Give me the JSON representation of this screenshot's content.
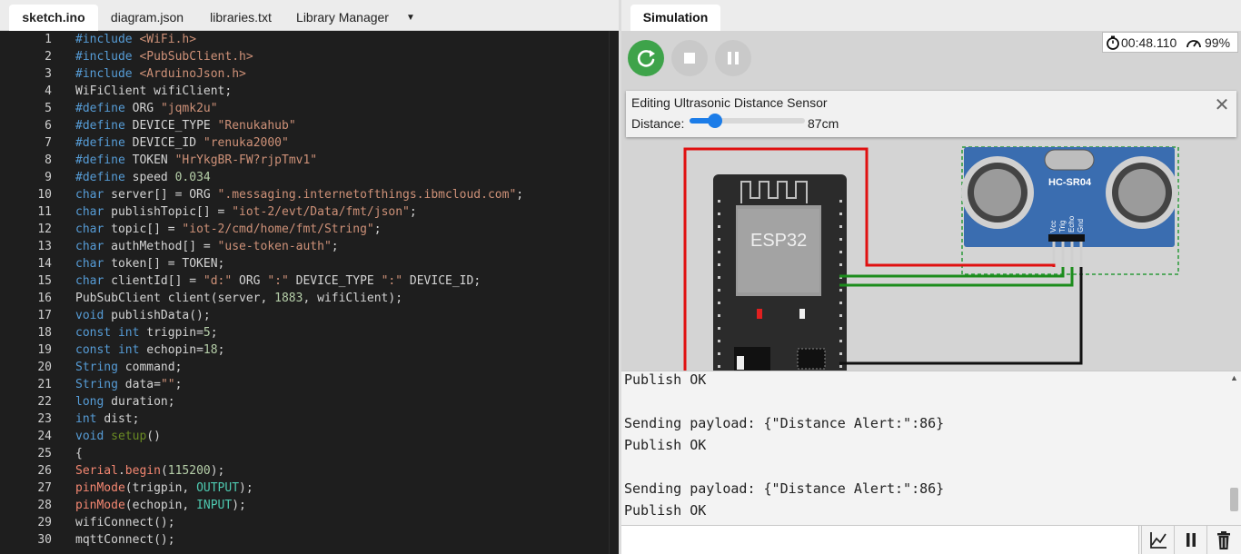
{
  "editor": {
    "tabs": [
      {
        "label": "sketch.ino",
        "active": true
      },
      {
        "label": "diagram.json",
        "active": false
      },
      {
        "label": "libraries.txt",
        "active": false
      },
      {
        "label": "Library Manager",
        "active": false
      }
    ],
    "dropdown_icon": "caret-down-icon",
    "lines": [
      {
        "n": "1",
        "tokens": [
          [
            "kw",
            "#include "
          ],
          [
            "str",
            "<WiFi.h>"
          ]
        ]
      },
      {
        "n": "2",
        "tokens": [
          [
            "kw",
            "#include "
          ],
          [
            "str",
            "<PubSubClient.h>"
          ]
        ]
      },
      {
        "n": "3",
        "tokens": [
          [
            "kw",
            "#include "
          ],
          [
            "str",
            "<ArduinoJson.h>"
          ]
        ]
      },
      {
        "n": "4",
        "tokens": [
          [
            "txt",
            "WiFiClient wifiClient;"
          ]
        ]
      },
      {
        "n": "5",
        "tokens": [
          [
            "kw",
            "#define "
          ],
          [
            "txt",
            "ORG "
          ],
          [
            "str",
            "\"jqmk2u\""
          ]
        ]
      },
      {
        "n": "6",
        "tokens": [
          [
            "kw",
            "#define "
          ],
          [
            "txt",
            "DEVICE_TYPE "
          ],
          [
            "str",
            "\"Renukahub\""
          ]
        ]
      },
      {
        "n": "7",
        "tokens": [
          [
            "kw",
            "#define "
          ],
          [
            "txt",
            "DEVICE_ID "
          ],
          [
            "str",
            "\"renuka2000\""
          ]
        ]
      },
      {
        "n": "8",
        "tokens": [
          [
            "kw",
            "#define "
          ],
          [
            "txt",
            "TOKEN "
          ],
          [
            "str",
            "\"HrYkgBR-FW?rjpTmv1\""
          ]
        ]
      },
      {
        "n": "9",
        "tokens": [
          [
            "kw",
            "#define "
          ],
          [
            "txt",
            "speed "
          ],
          [
            "num",
            "0.034"
          ]
        ]
      },
      {
        "n": "10",
        "tokens": [
          [
            "kw",
            "char "
          ],
          [
            "txt",
            "server[] = ORG "
          ],
          [
            "str",
            "\".messaging.internetofthings.ibmcloud.com\""
          ],
          [
            "txt",
            ";"
          ]
        ]
      },
      {
        "n": "11",
        "tokens": [
          [
            "kw",
            "char "
          ],
          [
            "txt",
            "publishTopic[] = "
          ],
          [
            "str",
            "\"iot-2/evt/Data/fmt/json\""
          ],
          [
            "txt",
            ";"
          ]
        ]
      },
      {
        "n": "12",
        "tokens": [
          [
            "kw",
            "char "
          ],
          [
            "txt",
            "topic[] = "
          ],
          [
            "str",
            "\"iot-2/cmd/home/fmt/String\""
          ],
          [
            "txt",
            ";"
          ]
        ]
      },
      {
        "n": "13",
        "tokens": [
          [
            "kw",
            "char "
          ],
          [
            "txt",
            "authMethod[] = "
          ],
          [
            "str",
            "\"use-token-auth\""
          ],
          [
            "txt",
            ";"
          ]
        ]
      },
      {
        "n": "14",
        "tokens": [
          [
            "kw",
            "char "
          ],
          [
            "txt",
            "token[] = TOKEN;"
          ]
        ]
      },
      {
        "n": "15",
        "tokens": [
          [
            "kw",
            "char "
          ],
          [
            "txt",
            "clientId[] = "
          ],
          [
            "str",
            "\"d:\""
          ],
          [
            "txt",
            " ORG "
          ],
          [
            "str",
            "\":\""
          ],
          [
            "txt",
            " DEVICE_TYPE "
          ],
          [
            "str",
            "\":\""
          ],
          [
            "txt",
            " DEVICE_ID;"
          ]
        ]
      },
      {
        "n": "16",
        "tokens": [
          [
            "txt",
            "PubSubClient client(server, "
          ],
          [
            "num",
            "1883"
          ],
          [
            "txt",
            ", wifiClient);"
          ]
        ]
      },
      {
        "n": "17",
        "tokens": [
          [
            "kw",
            "void "
          ],
          [
            "txt",
            "publishData();"
          ]
        ]
      },
      {
        "n": "18",
        "tokens": [
          [
            "kw",
            "const int "
          ],
          [
            "txt",
            "trigpin="
          ],
          [
            "num",
            "5"
          ],
          [
            "txt",
            ";"
          ]
        ]
      },
      {
        "n": "19",
        "tokens": [
          [
            "kw",
            "const int "
          ],
          [
            "txt",
            "echopin="
          ],
          [
            "num",
            "18"
          ],
          [
            "txt",
            ";"
          ]
        ]
      },
      {
        "n": "20",
        "tokens": [
          [
            "kw",
            "String "
          ],
          [
            "txt",
            "command;"
          ]
        ]
      },
      {
        "n": "21",
        "tokens": [
          [
            "kw",
            "String "
          ],
          [
            "txt",
            "data="
          ],
          [
            "str",
            "\"\""
          ],
          [
            "txt",
            ";"
          ]
        ]
      },
      {
        "n": "22",
        "tokens": [
          [
            "kw",
            "long "
          ],
          [
            "txt",
            "duration;"
          ]
        ]
      },
      {
        "n": "23",
        "tokens": [
          [
            "kw",
            "int "
          ],
          [
            "txt",
            "dist;"
          ]
        ]
      },
      {
        "n": "24",
        "tokens": [
          [
            "kw",
            "void "
          ],
          [
            "fn2",
            "setup"
          ],
          [
            "txt",
            "()"
          ]
        ]
      },
      {
        "n": "25",
        "tokens": [
          [
            "txt",
            "{"
          ]
        ]
      },
      {
        "n": "26",
        "tokens": [
          [
            "fn",
            "Serial"
          ],
          [
            "txt",
            "."
          ],
          [
            "fn",
            "begin"
          ],
          [
            "txt",
            "("
          ],
          [
            "num",
            "115200"
          ],
          [
            "txt",
            ");"
          ]
        ]
      },
      {
        "n": "27",
        "tokens": [
          [
            "fn",
            "pinMode"
          ],
          [
            "txt",
            "(trigpin, "
          ],
          [
            "const",
            "OUTPUT"
          ],
          [
            "txt",
            ");"
          ]
        ]
      },
      {
        "n": "28",
        "tokens": [
          [
            "fn",
            "pinMode"
          ],
          [
            "txt",
            "(echopin, "
          ],
          [
            "const",
            "INPUT"
          ],
          [
            "txt",
            ");"
          ]
        ]
      },
      {
        "n": "29",
        "tokens": [
          [
            "txt",
            "wifiConnect();"
          ]
        ]
      },
      {
        "n": "30",
        "tokens": [
          [
            "txt",
            "mqttConnect();"
          ]
        ]
      }
    ]
  },
  "simulation": {
    "tab_label": "Simulation",
    "controls": {
      "restart_icon": "restart-icon",
      "stop_icon": "stop-icon",
      "pause_icon": "pause-icon"
    },
    "timer": "00:48.110",
    "speed": "99%",
    "editor_panel": {
      "title": "Editing Ultrasonic Distance Sensor",
      "distance_label": "Distance:",
      "distance_value": "87cm",
      "slider_fraction": 0.22
    },
    "diagram": {
      "esp_label": "ESP32",
      "sensor_label": "HC-SR04",
      "sensor_pins": [
        "Vcc",
        "Trig",
        "Echo",
        "Gnd"
      ]
    },
    "serial_lines": [
      "Publish OK",
      "",
      "Sending payload: {\"Distance Alert:\":86}",
      "Publish OK",
      "",
      "Sending payload: {\"Distance Alert:\":86}",
      "Publish OK"
    ],
    "serial_buttons": [
      "plot-icon",
      "pause-icon",
      "trash-icon"
    ]
  },
  "colors": {
    "accent": "#3ea34a",
    "slider": "#1b7ce8",
    "editor_bg": "#1e1e1e",
    "sensor_blue": "#3a6db0"
  }
}
